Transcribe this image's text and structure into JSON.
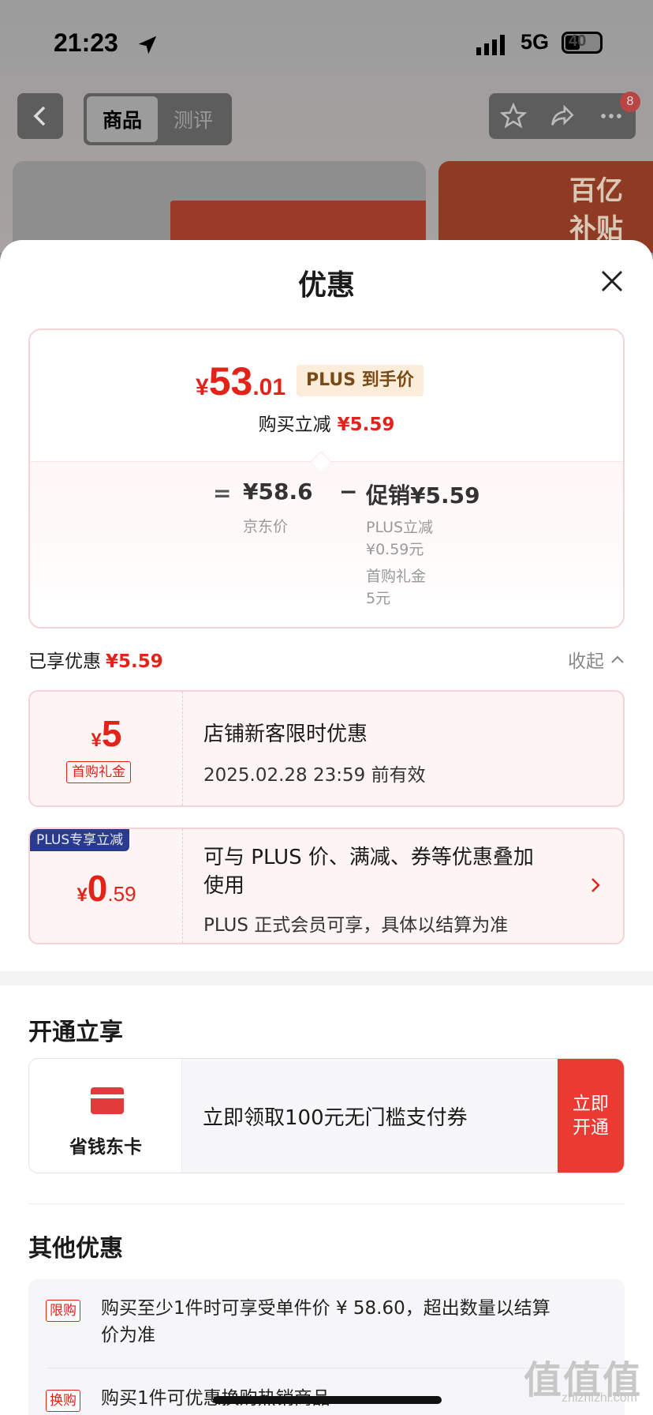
{
  "status_bar": {
    "time": "21:23",
    "network": "5G",
    "battery": "40"
  },
  "nav": {
    "tabs": [
      {
        "label": "商品",
        "active": true
      },
      {
        "label": "测评",
        "active": false
      }
    ],
    "badge": "8"
  },
  "hero": {
    "tag_line1": "百亿",
    "tag_line2": "补贴"
  },
  "sheet": {
    "title": "优惠",
    "price": {
      "currency": "¥",
      "integer": "53",
      "decimal": ".01",
      "plus_tag": "PLUS 到手价",
      "instant_label": "购买立减",
      "instant_value": "¥5.59"
    },
    "breakdown": {
      "equals": "=",
      "jd_price": "¥58.6",
      "jd_label": "京东价",
      "minus": "−",
      "promo": "促销¥5.59",
      "items": [
        {
          "name": "PLUS立减",
          "value": "¥0.59元"
        },
        {
          "name": "首购礼金",
          "value": "5元"
        }
      ]
    },
    "enjoyed_label": "已享优惠",
    "enjoyed_value": "¥5.59",
    "collapse_label": "收起",
    "coupons": [
      {
        "currency": "¥",
        "integer": "5",
        "decimal": "",
        "tag": "首购礼金",
        "title": "店铺新客限时优惠",
        "subtitle": "2025.02.28 23:59 前有效"
      },
      {
        "currency": "¥",
        "integer": "0",
        "decimal": ".59",
        "flag": "PLUS专享立减",
        "title_line1": "可与 PLUS 价、满减、券等优惠叠加",
        "title_line2": "使用",
        "subtitle": "PLUS 正式会员可享，具体以结算为准"
      }
    ],
    "open_section": {
      "title": "开通立享",
      "card_name": "省钱东卡",
      "desc": "立即领取100元无门槛支付券",
      "button_line1": "立即",
      "button_line2": "开通"
    },
    "other_section": {
      "title": "其他优惠",
      "items": [
        {
          "tag": "限购",
          "line1": "购买至少1件时可享受单件价 ¥ 58.60，超出数量以结算",
          "line2": "价为准"
        },
        {
          "tag": "换购",
          "line1": "购买1件可优惠换购热销商品",
          "line2": ""
        }
      ]
    }
  },
  "watermark": {
    "text": "值值值",
    "sub": "zhizhizhi.com"
  },
  "colors": {
    "accent_red": "#e2231a",
    "plus_blue": "#2a3a8c",
    "plus_gold_bg": "#fbedd9"
  }
}
